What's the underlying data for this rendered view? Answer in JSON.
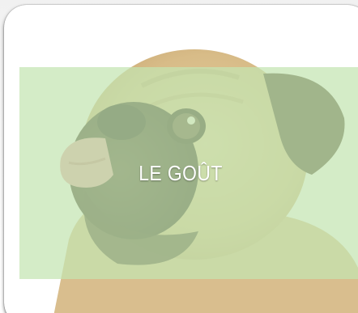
{
  "card": {
    "caption": "LE GOÛT",
    "image_subject": "pug-licking-nose",
    "overlay_color": "#c4e4b2"
  }
}
